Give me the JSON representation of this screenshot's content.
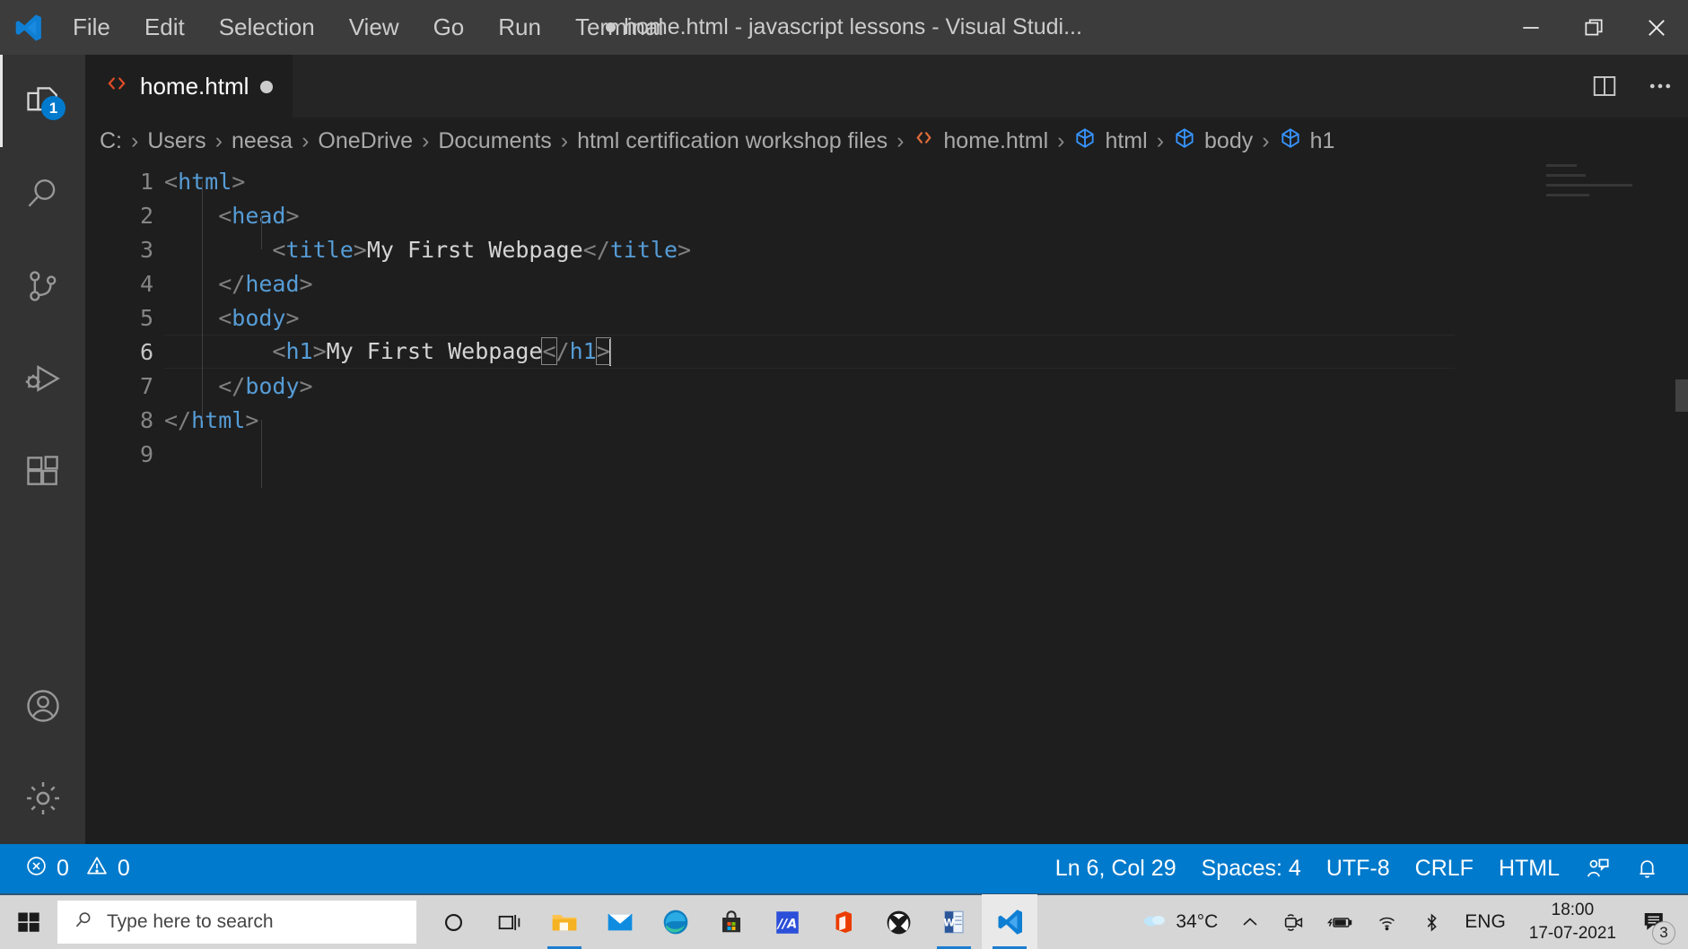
{
  "titlebar": {
    "logo_icon": "vscode-logo-icon",
    "menus": [
      "File",
      "Edit",
      "Selection",
      "View",
      "Go",
      "Run",
      "Terminal"
    ],
    "title": "home.html - javascript lessons - Visual Studi...",
    "dirty_indicator": "●",
    "window_controls": {
      "minimize": "minimize-icon",
      "restore": "restore-icon",
      "close": "close-icon"
    }
  },
  "activitybar": {
    "items": [
      {
        "name": "explorer",
        "icon": "files-icon",
        "badge": "1",
        "active": true
      },
      {
        "name": "search",
        "icon": "search-icon",
        "badge": "",
        "active": false
      },
      {
        "name": "source-control",
        "icon": "source-control-icon",
        "badge": "",
        "active": false
      },
      {
        "name": "run-and-debug",
        "icon": "run-debug-icon",
        "badge": "",
        "active": false
      },
      {
        "name": "extensions",
        "icon": "extensions-icon",
        "badge": "",
        "active": false
      },
      {
        "name": "accounts",
        "icon": "account-icon",
        "badge": "",
        "active": false
      },
      {
        "name": "manage",
        "icon": "gear-icon",
        "badge": "",
        "active": false
      }
    ]
  },
  "editor": {
    "tab": {
      "label": "home.html",
      "icon": "html-file-icon",
      "dirty": true
    },
    "tab_actions": [
      {
        "name": "split-editor",
        "icon": "split-editor-icon"
      },
      {
        "name": "more-actions",
        "icon": "ellipsis-icon"
      }
    ],
    "breadcrumbs": [
      {
        "label": "C:",
        "icon": ""
      },
      {
        "label": "Users",
        "icon": ""
      },
      {
        "label": "neesa",
        "icon": ""
      },
      {
        "label": "OneDrive",
        "icon": ""
      },
      {
        "label": "Documents",
        "icon": ""
      },
      {
        "label": "html certification workshop files",
        "icon": ""
      },
      {
        "label": "home.html",
        "icon": "html-tag-icon"
      },
      {
        "label": "html",
        "icon": "symbol-field-icon"
      },
      {
        "label": "body",
        "icon": "symbol-field-icon"
      },
      {
        "label": "h1",
        "icon": "symbol-field-icon"
      }
    ],
    "separator": "›",
    "lines": [
      {
        "num": "1",
        "indent": 0,
        "tokens": [
          {
            "t": "<",
            "c": "punct"
          },
          {
            "t": "html",
            "c": "tag"
          },
          {
            "t": ">",
            "c": "punct"
          }
        ]
      },
      {
        "num": "2",
        "indent": 1,
        "tokens": [
          {
            "t": "<",
            "c": "punct"
          },
          {
            "t": "head",
            "c": "tag"
          },
          {
            "t": ">",
            "c": "punct"
          }
        ]
      },
      {
        "num": "3",
        "indent": 2,
        "tokens": [
          {
            "t": "<",
            "c": "punct"
          },
          {
            "t": "title",
            "c": "tag"
          },
          {
            "t": ">",
            "c": "punct"
          },
          {
            "t": "My First Webpage",
            "c": "text"
          },
          {
            "t": "</",
            "c": "punct"
          },
          {
            "t": "title",
            "c": "tag"
          },
          {
            "t": ">",
            "c": "punct"
          }
        ]
      },
      {
        "num": "4",
        "indent": 1,
        "tokens": [
          {
            "t": "</",
            "c": "punct"
          },
          {
            "t": "head",
            "c": "tag"
          },
          {
            "t": ">",
            "c": "punct"
          }
        ]
      },
      {
        "num": "5",
        "indent": 1,
        "tokens": [
          {
            "t": "<",
            "c": "punct"
          },
          {
            "t": "body",
            "c": "tag"
          },
          {
            "t": ">",
            "c": "punct"
          }
        ]
      },
      {
        "num": "6",
        "indent": 2,
        "current": true,
        "tokens": [
          {
            "t": "<",
            "c": "punct"
          },
          {
            "t": "h1",
            "c": "tag"
          },
          {
            "t": ">",
            "c": "punct"
          },
          {
            "t": "My First Webpage",
            "c": "text"
          },
          {
            "t": "<",
            "c": "punct",
            "bracket": true
          },
          {
            "t": "/",
            "c": "punct"
          },
          {
            "t": "h1",
            "c": "tag"
          },
          {
            "t": ">",
            "c": "punct",
            "bracket": true
          },
          {
            "t": "",
            "c": "cursor"
          }
        ]
      },
      {
        "num": "7",
        "indent": 1,
        "tokens": [
          {
            "t": "</",
            "c": "punct"
          },
          {
            "t": "body",
            "c": "tag"
          },
          {
            "t": ">",
            "c": "punct"
          }
        ]
      },
      {
        "num": "8",
        "indent": 0,
        "tokens": [
          {
            "t": "</",
            "c": "punct"
          },
          {
            "t": "html",
            "c": "tag"
          },
          {
            "t": ">",
            "c": "punct"
          }
        ]
      },
      {
        "num": "9",
        "indent": 0,
        "tokens": []
      }
    ]
  },
  "statusbar": {
    "errors": {
      "icon": "error-icon",
      "count": "0"
    },
    "warnings": {
      "icon": "warning-icon",
      "count": "0"
    },
    "cursor_position": "Ln 6, Col 29",
    "indentation": "Spaces: 4",
    "encoding": "UTF-8",
    "eol": "CRLF",
    "language": "HTML",
    "feedback_icon": "feedback-icon",
    "notifications_icon": "bell-icon",
    "background": "#007acc"
  },
  "taskbar": {
    "start_icon": "windows-start-icon",
    "search_placeholder": "Type here to search",
    "search_icon": "search-icon",
    "pinned": [
      {
        "name": "cortana",
        "icon": "cortana-icon"
      },
      {
        "name": "task-view",
        "icon": "task-view-icon"
      },
      {
        "name": "file-explorer",
        "icon": "file-explorer-icon",
        "running": true
      },
      {
        "name": "mail",
        "icon": "mail-icon"
      },
      {
        "name": "microsoft-edge",
        "icon": "edge-icon"
      },
      {
        "name": "microsoft-store",
        "icon": "store-icon"
      },
      {
        "name": "blue-app",
        "icon": "blue-app-icon"
      },
      {
        "name": "microsoft-office",
        "icon": "office-icon"
      },
      {
        "name": "xbox",
        "icon": "xbox-icon"
      },
      {
        "name": "microsoft-word",
        "icon": "word-icon",
        "running": true
      },
      {
        "name": "visual-studio-code",
        "icon": "vscode-icon",
        "running": true,
        "active": true
      }
    ],
    "tray": {
      "weather_icon": "cloud-icon",
      "weather_temp": "34°C",
      "show_hidden_icon": "chevron-up-icon",
      "meet_now_icon": "meet-now-icon",
      "battery_icon": "battery-charging-icon",
      "network_icon": "wifi-icon",
      "bluetooth_icon": "bluetooth-icon",
      "language": "ENG",
      "time": "18:00",
      "date": "17-07-2021",
      "notifications_icon": "action-center-icon",
      "notifications_count": "3"
    }
  }
}
